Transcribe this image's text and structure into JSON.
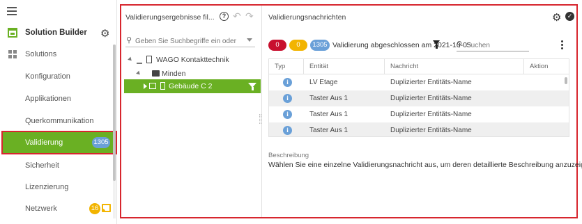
{
  "sidebar": {
    "app_title": "Solution Builder",
    "items": [
      {
        "label": "Solutions"
      },
      {
        "label": "Konfiguration"
      },
      {
        "label": "Applikationen"
      },
      {
        "label": "Querkommunikation"
      },
      {
        "label": "Validierung",
        "badge": "1305"
      },
      {
        "label": "Sicherheit"
      },
      {
        "label": "Lizenzierung"
      },
      {
        "label": "Netzwerk",
        "badge": "16"
      }
    ]
  },
  "tree_panel": {
    "title": "Validierungsergebnisse fil...",
    "search_placeholder": "Geben Sie Suchbegriffe ein oder",
    "nodes": [
      {
        "label": "WAGO Kontakttechnik"
      },
      {
        "label": "Minden"
      },
      {
        "label": "Gebäude C 2"
      }
    ]
  },
  "messages_panel": {
    "title": "Validierungsnachrichten",
    "counts": {
      "errors": "0",
      "warnings": "0",
      "infos": "1305"
    },
    "status": "Validierung abgeschlossen am 2021-10-05",
    "search_placeholder": "Suchen",
    "columns": [
      "Typ",
      "Entität",
      "Nachricht",
      "Aktion"
    ],
    "rows": [
      {
        "type_icon": "i",
        "entity": "LV Etage",
        "message": "Duplizierter Entitäts-Name",
        "action": ""
      },
      {
        "type_icon": "i",
        "entity": "Taster Aus 1",
        "message": "Duplizierter Entitäts-Name",
        "action": ""
      },
      {
        "type_icon": "i",
        "entity": "Taster Aus 1",
        "message": "Duplizierter Entitäts-Name",
        "action": ""
      },
      {
        "type_icon": "i",
        "entity": "Taster Aus 1",
        "message": "Duplizierter Entitäts-Name",
        "action": ""
      }
    ],
    "description_label": "Beschreibung",
    "description_text": "Wählen Sie eine einzelne Validierungsnachricht aus, um deren detaillierte Beschreibung anzuzeigen."
  },
  "colors": {
    "accent_green": "#6ab023",
    "highlight_red": "#d7262e",
    "info_blue": "#6aa0d8",
    "warning_yellow": "#f2b400",
    "error_red": "#c8102e"
  }
}
